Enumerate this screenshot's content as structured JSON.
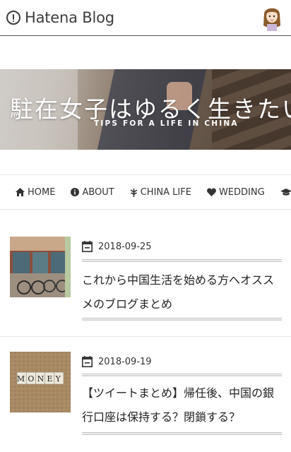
{
  "topbar": {
    "brand": "Hatena Blog",
    "brand_icon": "hatena-logo-icon",
    "avatar_icon": "user-avatar-icon"
  },
  "banner": {
    "title": "駐在女子はゆるく生きたい",
    "tagline": "TIPS FOR A LIFE IN CHINA"
  },
  "nav": {
    "items": [
      {
        "label": "HOME",
        "icon": "home-icon"
      },
      {
        "label": "ABOUT",
        "icon": "info-icon"
      },
      {
        "label": "CHINA LIFE",
        "icon": "leaf-icon"
      },
      {
        "label": "WEDDING",
        "icon": "heart-icon"
      },
      {
        "label": "",
        "icon": "graduation-cap-icon"
      }
    ]
  },
  "articles": [
    {
      "date": "2018-09-25",
      "title": "これから中国生活を始める方へオススメのブログまとめ",
      "thumb_icon": "street-bicycles-photo"
    },
    {
      "date": "2018-09-19",
      "title": "【ツイートまとめ】帰任後、中国の銀行口座は保持する？閉鎖する？",
      "thumb_icon": "money-blocks-photo",
      "thumb_text": "MONEY"
    }
  ],
  "colors": {
    "text": "#333333",
    "rule": "#bdbdbd",
    "brand": "#3d3d3d"
  }
}
